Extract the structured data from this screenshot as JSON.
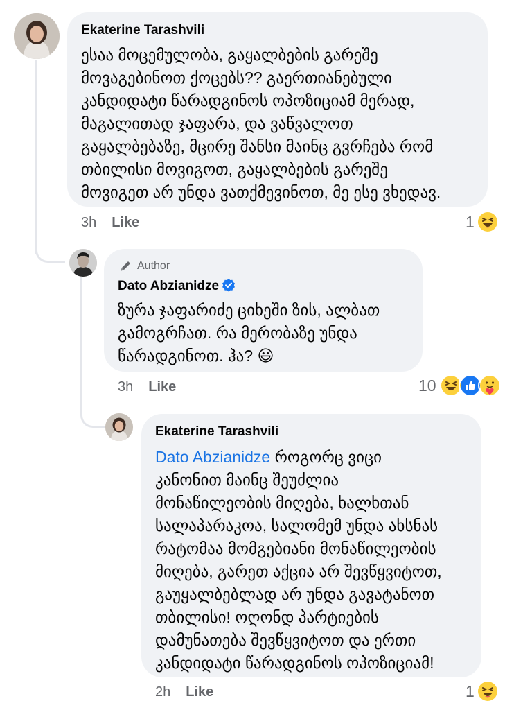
{
  "comments": [
    {
      "author": "Ekaterine Tarashvili",
      "lines": [
        "ესაა მოცემულობა, გაყალბების გარეშე",
        "მოვაგებინოთ ქოცებს?? გაერთიანებული",
        "კანდიდატი წარადგინოს ოპოზიციამ მერად,",
        "მაგალითად ჯაფარა, და ვაწვალოთ",
        "გაყალბებაზე, მცირე შანსი მაინც გვრჩება რომ",
        "თბილისი მოვიგოთ, გაყალბების გარეშე",
        "მოვიგეთ არ უნდა ვათქმევინოთ, მე ესე ვხედავ."
      ],
      "time": "3h",
      "like_label": "Like",
      "reaction_count": "1"
    },
    {
      "author_badge": "Author",
      "author": "Dato Abzianidze",
      "lines": [
        "ზურა ჯაფარიძე ციხეში ზის, ალბათ",
        "გამოგრჩათ. რა მერობაზე უნდა",
        "წარადგინოთ. ჰა? 😃"
      ],
      "time": "3h",
      "like_label": "Like",
      "reaction_count": "10"
    },
    {
      "author": "Ekaterine Tarashvili",
      "mention": "Dato Abzianidze",
      "first_line_rest": " როგორც ვიცი",
      "lines": [
        "კანონით მაინც შეუძლია",
        "მონაწილეობის მიღება, ხალხთან",
        "სალაპარაკოა, სალომემ უნდა ახსნას",
        "რატომაა მომგებიანი  მონაწილეობის",
        "მიღება, გარეთ აქცია არ შევწყვიტოთ,",
        "გაუყალბებლად არ უნდა გავატანოთ",
        "თბილისი! ოღონდ პარტიების",
        "დამუნათება შევწყვიტოთ და ერთი",
        "კანდიდატი წარადგინოს ოპოზიციამ!"
      ],
      "time": "2h",
      "like_label": "Like",
      "reaction_count": "1"
    }
  ],
  "colors": {
    "bubble": "#f0f2f5",
    "meta_text": "#65676b",
    "mention": "#1b74e4",
    "verified": "#1877f2",
    "thread_line": "#e4e6eb"
  }
}
